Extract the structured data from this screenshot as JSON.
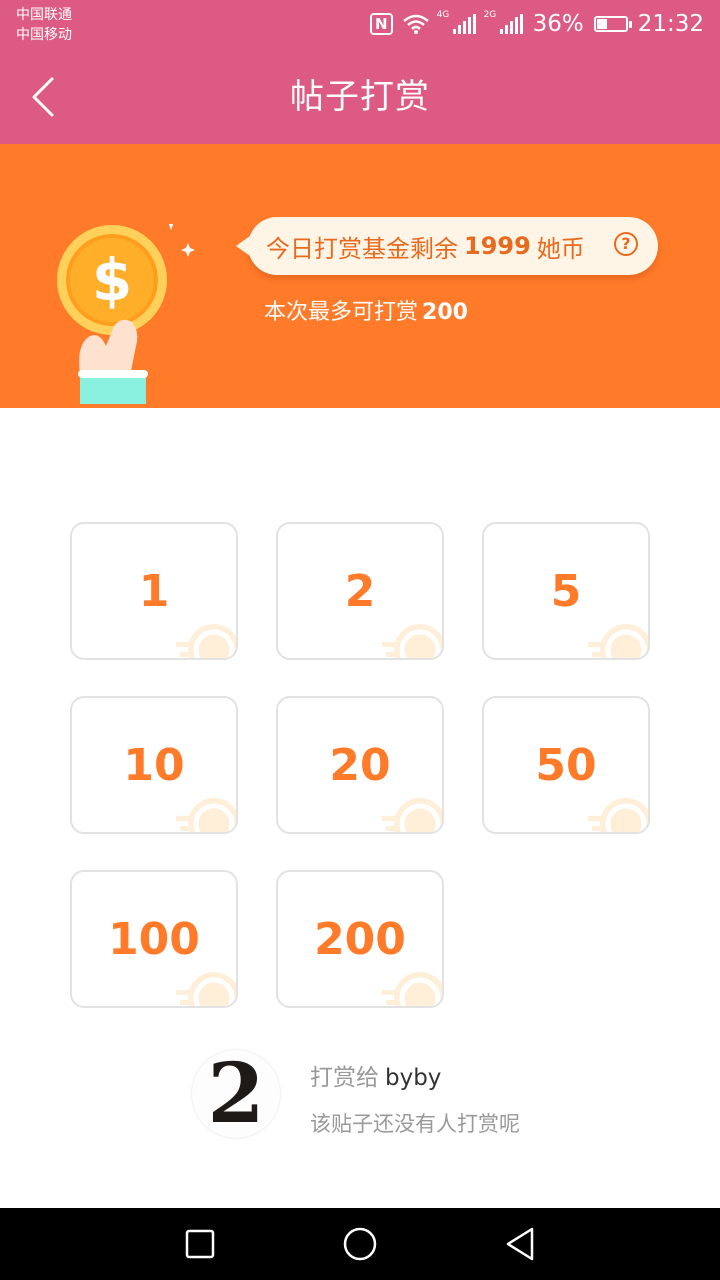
{
  "status_bar": {
    "carrier1": "中国联通",
    "carrier2": "中国移动",
    "nfc": "N",
    "signal1_tag": "4G",
    "signal2_tag": "2G",
    "battery": "36%",
    "battery_level": 0.36,
    "time": "21:32"
  },
  "app_bar": {
    "title": "帖子打赏",
    "back_icon": "chevron-left-icon"
  },
  "banner": {
    "fund_prefix": "今日打赏基金剩余",
    "fund_amount": "1999",
    "fund_unit": "她币",
    "help_icon": "?",
    "limit_label": "本次最多可打赏",
    "limit_amount": "200"
  },
  "amounts": [
    "1",
    "2",
    "5",
    "10",
    "20",
    "50",
    "100",
    "200"
  ],
  "recipient": {
    "prefix": "打赏给",
    "name": "byby",
    "avatar_text": "2",
    "empty_note": "该贴子还没有人打赏呢"
  },
  "colors": {
    "header": "#dd5a84",
    "banner": "#ff7a29",
    "amount": "#ff7a29"
  },
  "nav_bar": {
    "icons": [
      "recent-apps-icon",
      "home-icon",
      "back-icon"
    ]
  }
}
